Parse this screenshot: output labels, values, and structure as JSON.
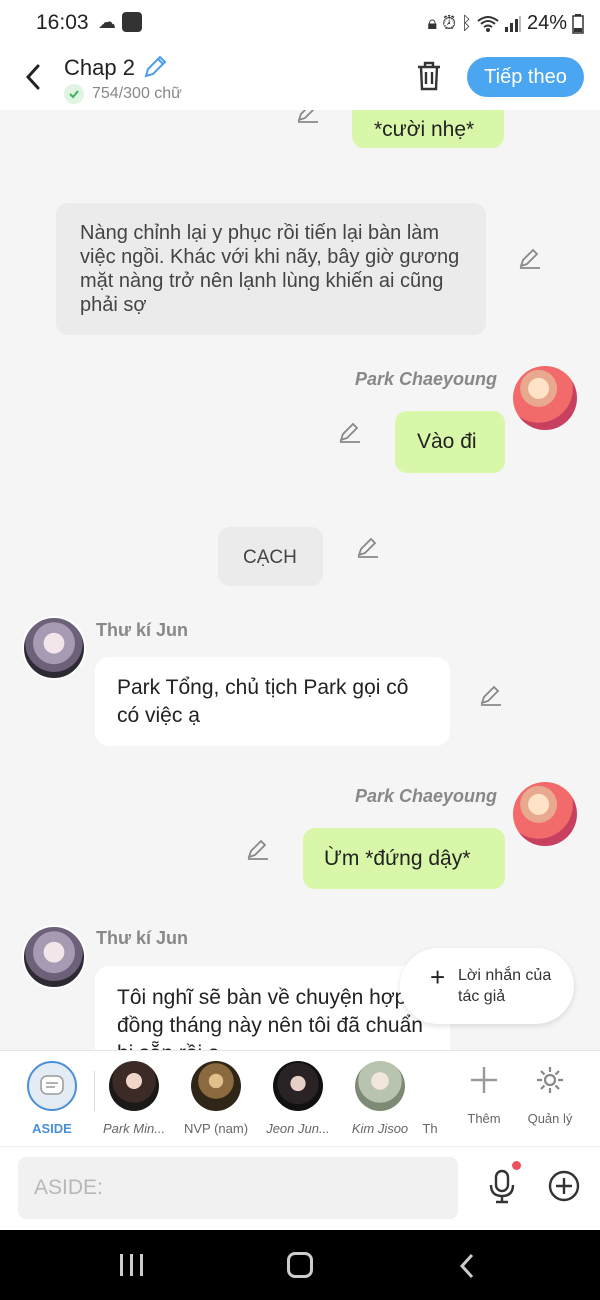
{
  "status": {
    "time": "16:03",
    "battery": "24%"
  },
  "header": {
    "title": "Chap 2",
    "word_count": "754/300 chữ",
    "next_label": "Tiếp theo"
  },
  "messages": [
    {
      "type": "right",
      "text": "*cười nhẹ*"
    },
    {
      "type": "narration",
      "text": "Nàng chỉnh lại y phục rồi tiến lại bàn làm việc ngồi. Khác với khi nãy, bây giờ gương mặt nàng trở nên lạnh lùng khiến ai cũng phải sợ"
    },
    {
      "type": "right",
      "speaker": "Park Chaeyoung",
      "text": "Vào đi"
    },
    {
      "type": "sfx",
      "text": "CẠCH"
    },
    {
      "type": "left",
      "speaker": "Thư kí Jun",
      "text": "Park Tổng, chủ tịch Park gọi cô có việc ạ"
    },
    {
      "type": "right",
      "speaker": "Park Chaeyoung",
      "text": "Ừm *đứng dậy*"
    },
    {
      "type": "left",
      "speaker": "Thư kí Jun",
      "text": "Tôi nghĩ sẽ bàn về chuyện hợp đồng tháng này nên tôi đã chuẩn bị sẵn rồi ạ"
    }
  ],
  "author_note": {
    "label": "Lời nhắn của tác giả"
  },
  "characters": [
    {
      "label": "ASIDE"
    },
    {
      "label": "Park Min..."
    },
    {
      "label": "NVP (nam)"
    },
    {
      "label": "Jeon Jun..."
    },
    {
      "label": "Kim Jisoo"
    },
    {
      "label": "Th"
    }
  ],
  "actions": {
    "add_label": "Thêm",
    "manage_label": "Quản lý"
  },
  "input": {
    "placeholder": "ASIDE:"
  },
  "colors": {
    "accent": "#4aa6f0",
    "green_bubble": "#d9f7a8",
    "mic_dot": "#f04e5e"
  }
}
